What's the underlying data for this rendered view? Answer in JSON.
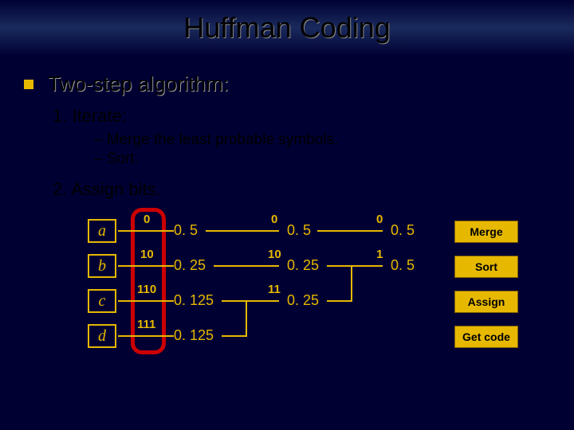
{
  "title": "Huffman Coding",
  "bullet_main": "Two-step algorithm:",
  "step1": "1.  Iterate:",
  "step1a": "–   Merge the least probable symbols.",
  "step1b": "–   Sort.",
  "step2": "2.  Assign bits.",
  "symbols": {
    "a": "a",
    "b": "b",
    "c": "c",
    "d": "d"
  },
  "col1": {
    "bits": {
      "a": "0",
      "b": "10",
      "c": "110",
      "d": "111"
    },
    "probs": {
      "a": "0. 5",
      "b": "0. 25",
      "c": "0. 125",
      "d": "0. 125"
    }
  },
  "col2": {
    "bits": {
      "r1": "0",
      "r2": "10",
      "r3": "11"
    },
    "probs": {
      "r1": "0. 5",
      "r2": "0. 25",
      "r3": "0. 25"
    }
  },
  "col3": {
    "bits": {
      "r1": "0",
      "r2": "1"
    },
    "probs": {
      "r1": "0. 5",
      "r2": "0. 5"
    }
  },
  "buttons": {
    "merge": "Merge",
    "sort": "Sort",
    "assign": "Assign",
    "getcode": "Get code"
  }
}
